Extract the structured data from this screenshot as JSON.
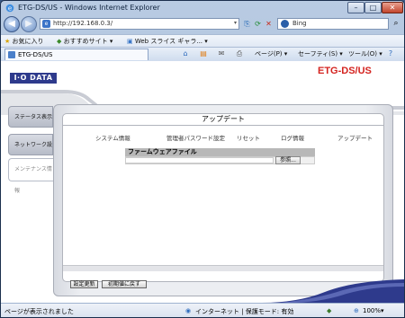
{
  "window": {
    "title": "ETG-DS/US - Windows Internet Explorer"
  },
  "addressbar": {
    "url": "http://192.168.0.3/",
    "search_text": "Bing"
  },
  "favorites_bar": {
    "favorites_label": "お気に入り",
    "suggested_sites": "おすすめサイト ▾",
    "web_slice": "Web スライス ギャラ... ▾"
  },
  "tab": {
    "label": "ETG-DS/US"
  },
  "commandbar": {
    "page": "ページ(P) ▾",
    "safety": "セーフティ(S) ▾",
    "tools": "ツール(O) ▾"
  },
  "page": {
    "logo": "I·O DATA",
    "product": "ETG-DS/US",
    "sidebar": [
      {
        "label": "ステータス表示"
      },
      {
        "label": "ネットワーク設定"
      },
      {
        "label": "メンテナンス情報"
      }
    ],
    "panel_title": "アップデート",
    "menu": [
      {
        "label": "システム情報"
      },
      {
        "label": "管理者パスワード設定"
      },
      {
        "label": "リセット"
      },
      {
        "label": "ログ情報"
      },
      {
        "label": "アップデート"
      }
    ],
    "firmware_label": "ファームウェアファイル",
    "browse_label": "参照...",
    "buttons": {
      "apply": "設定更新",
      "reset": "初期値に戻す"
    }
  },
  "statusbar": {
    "message": "ページが表示されました",
    "zone": "インターネット | 保護モード: 有効",
    "zoom": "100%"
  }
}
